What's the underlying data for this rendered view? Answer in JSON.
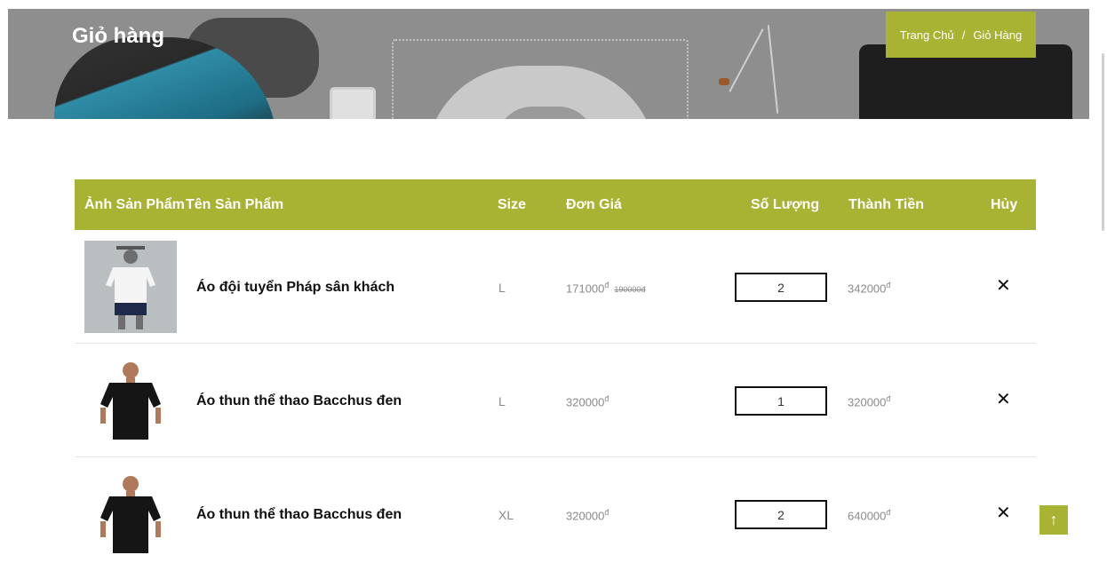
{
  "header": {
    "title": "Giỏ hàng",
    "breadcrumb": {
      "home": "Trang Chủ",
      "separator": "/",
      "current": "Giỏ Hàng"
    }
  },
  "table": {
    "columns": [
      "Ảnh Sản Phẩm",
      "Tên Sản Phẩm",
      "Size",
      "Đơn Giá",
      "Số Lượng",
      "Thành Tiền",
      "Hủy"
    ],
    "currency": "đ",
    "rows": [
      {
        "name": "Áo đội tuyển Pháp sân khách",
        "size": "L",
        "price": "171000",
        "old_price": "190000đ",
        "qty": "2",
        "total": "342000",
        "image": "white-jersey-mannequin"
      },
      {
        "name": "Áo thun thể thao Bacchus đen",
        "size": "L",
        "price": "320000",
        "old_price": "",
        "qty": "1",
        "total": "320000",
        "image": "black-tshirt-model"
      },
      {
        "name": "Áo thun thể thao Bacchus đen",
        "size": "XL",
        "price": "320000",
        "old_price": "",
        "qty": "2",
        "total": "640000",
        "image": "black-tshirt-model"
      }
    ]
  },
  "icons": {
    "remove": "✕",
    "remove_name": "close-icon",
    "back_to_top": "↑",
    "back_to_top_name": "arrow-up-icon"
  },
  "colors": {
    "accent": "#a8b233",
    "hero": "#8e8e8e",
    "text_muted": "#8a8a8a"
  }
}
